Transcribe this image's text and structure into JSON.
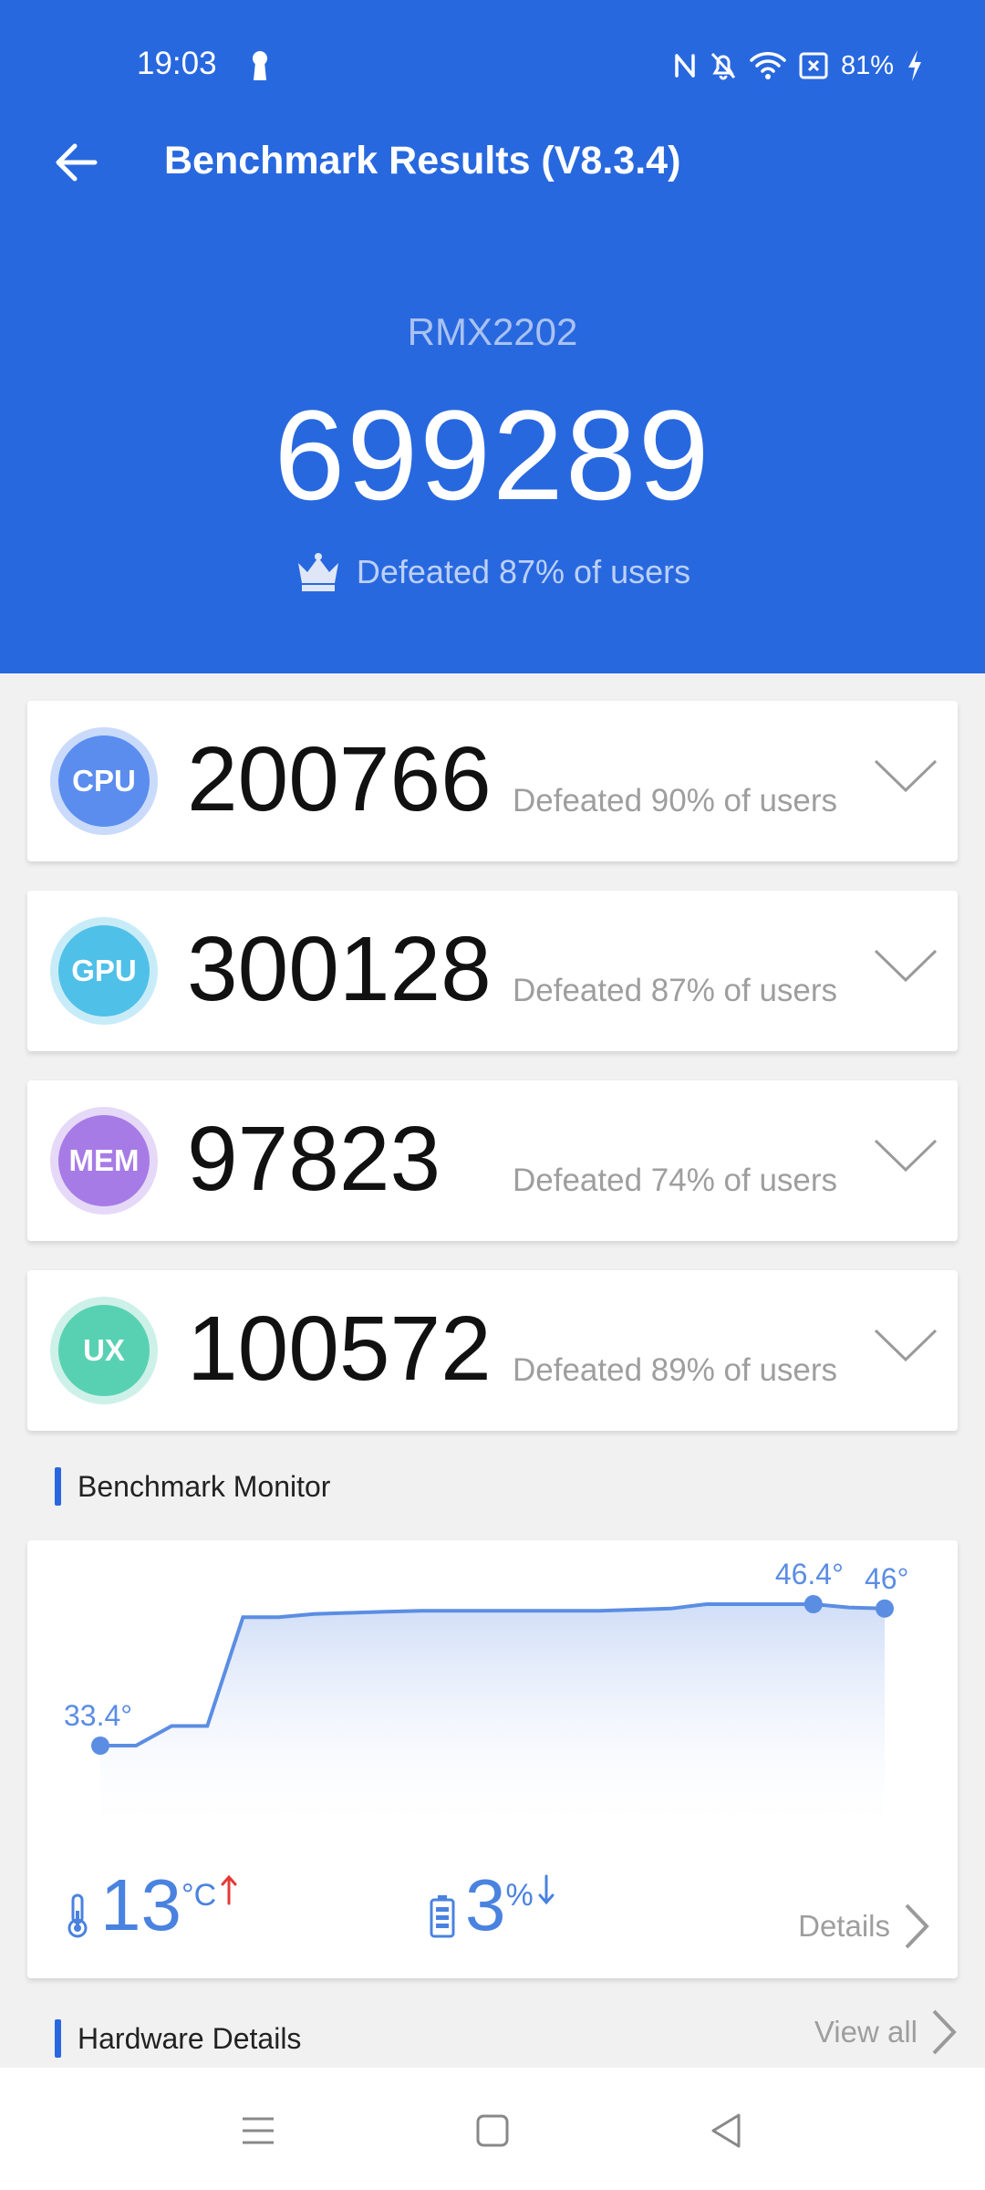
{
  "status_bar": {
    "time": "19:03",
    "battery_percent": "81%"
  },
  "app_bar": {
    "title": "Benchmark Results (V8.3.4)"
  },
  "summary": {
    "model": "RMX2202",
    "total_score": "699289",
    "defeated": "Defeated 87% of users"
  },
  "cards": [
    {
      "badge": "CPU",
      "score": "200766",
      "defeated": "Defeated 90% of users",
      "color": "#5b8def",
      "ring": "#c9dafb"
    },
    {
      "badge": "GPU",
      "score": "300128",
      "defeated": "Defeated 87% of users",
      "color": "#4fc0e8",
      "ring": "#c7ecf8"
    },
    {
      "badge": "MEM",
      "score": "97823",
      "defeated": "Defeated 74% of users",
      "color": "#a77be6",
      "ring": "#e6d9f8"
    },
    {
      "badge": "UX",
      "score": "100572",
      "defeated": "Defeated 89% of users",
      "color": "#58d1b2",
      "ring": "#cdf1e8"
    }
  ],
  "monitor": {
    "section_label": "Benchmark Monitor",
    "start_temp": "33.4°",
    "peak_temp": "46.4°",
    "end_temp": "46°",
    "temp_rise": "13",
    "temp_unit": "°C",
    "battery_drop": "3",
    "battery_unit": "%",
    "details_label": "Details",
    "chart_data": {
      "type": "area",
      "values": [
        33.4,
        33.4,
        35.2,
        35.2,
        45.2,
        45.2,
        45.5,
        45.6,
        45.7,
        45.8,
        45.8,
        45.8,
        45.8,
        45.8,
        45.8,
        45.9,
        46.0,
        46.4,
        46.4,
        46.4,
        46.4,
        46.1,
        46.0
      ]
    }
  },
  "hardware": {
    "section_label": "Hardware Details",
    "view_all_label": "View all"
  }
}
